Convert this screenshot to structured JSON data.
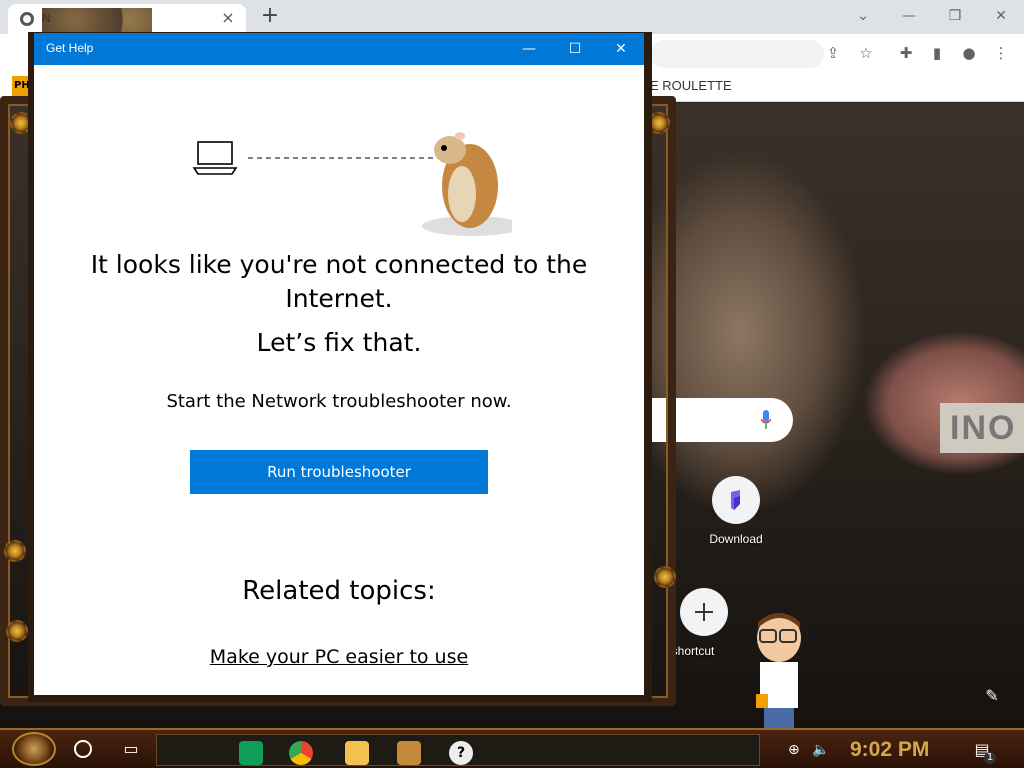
{
  "browser": {
    "tab_title": "N",
    "tab_close": "×",
    "new_tab": "+",
    "bookmark_badge": "PH",
    "bookmark_text": "E ROULETTE",
    "window_controls": {
      "chevron": "⌄",
      "minimize": "—",
      "restore": "❐",
      "close": "✕"
    },
    "toolbar_icons": {
      "share": "⇪",
      "star": "☆",
      "extensions": "✚",
      "sidebar": "▮",
      "profile": "●",
      "menu": "⋮"
    },
    "sign_text": "INO",
    "shortcuts": [
      {
        "label": "Download",
        "icon": "download-app-icon"
      },
      {
        "label": "shortcut",
        "icon": "plus-icon"
      }
    ]
  },
  "dialog": {
    "title": "Get Help",
    "controls": {
      "minimize": "—",
      "maximize": "☐",
      "close": "✕"
    },
    "heading": "It looks like you're not connected to the Internet.",
    "subheading": "Let’s fix that.",
    "info": "Start the Network troubleshooter now.",
    "button_label": "Run troubleshooter",
    "related_title": "Related topics:",
    "related_link": "Make your PC easier to use"
  },
  "taskbar": {
    "task_view_icon": "▭",
    "apps": [
      "sheets-icon",
      "chrome-icon",
      "folder-icon",
      "game-icon",
      "help-icon"
    ],
    "tray_network": "⊕",
    "tray_volume": "🔈",
    "clock": "9:02 PM",
    "notification_icon": "▤",
    "notification_count": "1"
  },
  "colors": {
    "accent": "#0078d7",
    "clock": "#d4a84a",
    "taskbar": "#3a1a0a"
  }
}
